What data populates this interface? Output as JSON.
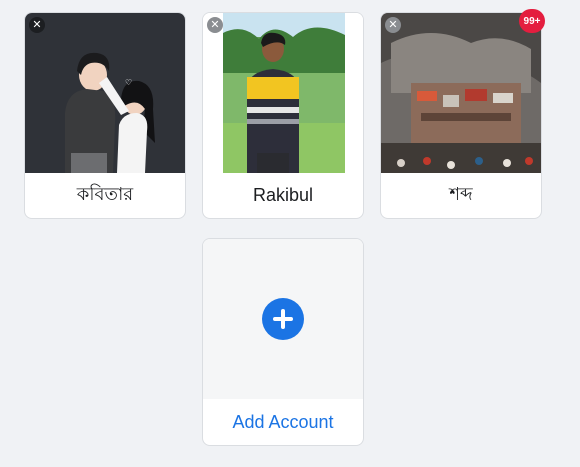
{
  "accounts": [
    {
      "name": "কবিতার",
      "photo_icon": "couple-illustration-avatar"
    },
    {
      "name": "Rakibul",
      "photo_icon": "man-yellow-sweater-photo"
    },
    {
      "name": "শব্দ",
      "photo_icon": "burning-building-photo",
      "notification_badge": "99+"
    }
  ],
  "add_account": {
    "label": "Add Account",
    "icon": "plus-icon"
  },
  "colors": {
    "background": "#f0f2f5",
    "accent": "#1b74e4",
    "badge": "#e41e3f",
    "card_border": "#dadde1"
  }
}
